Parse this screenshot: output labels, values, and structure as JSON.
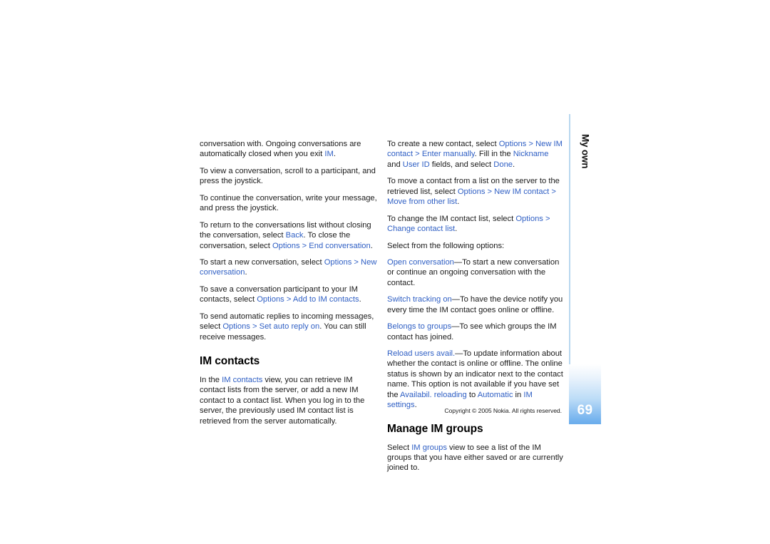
{
  "document": {
    "page_number": "69",
    "chapter_label": "My own",
    "copyright": "Copyright © 2005 Nokia. All rights reserved.",
    "accent_color": "#2f5fc4",
    "rail_line_color": "#b9d7ef",
    "page_tab_color": "#6aacec"
  },
  "left_column": {
    "paragraphs": [
      {
        "id": "p-ongoing-conversations",
        "runs": [
          {
            "t": "conversation with. Ongoing conversations are automatically closed when you exit ",
            "s": "plain"
          },
          {
            "t": "IM",
            "s": "ui"
          },
          {
            "t": ".",
            "s": "plain"
          }
        ]
      },
      {
        "id": "p-view-conversation",
        "runs": [
          {
            "t": "To view a conversation, scroll to a participant, and press the joystick.",
            "s": "plain"
          }
        ]
      },
      {
        "id": "p-continue-conversation",
        "runs": [
          {
            "t": "To continue the conversation, write your message, and press the joystick.",
            "s": "plain"
          }
        ]
      },
      {
        "id": "p-return-to-list",
        "runs": [
          {
            "t": "To return to the conversations list without closing the conversation, select ",
            "s": "plain"
          },
          {
            "t": "Back",
            "s": "ui"
          },
          {
            "t": ". To close the conversation, select ",
            "s": "plain"
          },
          {
            "t": "Options",
            "s": "ui"
          },
          {
            "t": " > ",
            "s": "sep"
          },
          {
            "t": "End conversation",
            "s": "ui"
          },
          {
            "t": ".",
            "s": "plain"
          }
        ]
      },
      {
        "id": "p-start-new-conversation",
        "runs": [
          {
            "t": "To start a new conversation, select ",
            "s": "plain"
          },
          {
            "t": "Options",
            "s": "ui"
          },
          {
            "t": " > ",
            "s": "sep"
          },
          {
            "t": "New conversation",
            "s": "ui"
          },
          {
            "t": ".",
            "s": "plain"
          }
        ]
      },
      {
        "id": "p-save-participant",
        "runs": [
          {
            "t": "To save a conversation participant to your IM contacts, select ",
            "s": "plain"
          },
          {
            "t": "Options",
            "s": "ui"
          },
          {
            "t": " > ",
            "s": "sep"
          },
          {
            "t": "Add to IM contacts",
            "s": "ui"
          },
          {
            "t": ".",
            "s": "plain"
          }
        ]
      },
      {
        "id": "p-auto-reply",
        "runs": [
          {
            "t": "To send automatic replies to incoming messages, select ",
            "s": "plain"
          },
          {
            "t": "Options",
            "s": "ui"
          },
          {
            "t": " > ",
            "s": "sep"
          },
          {
            "t": "Set auto reply on",
            "s": "ui"
          },
          {
            "t": ". You can still receive messages.",
            "s": "plain"
          }
        ]
      }
    ],
    "heading": "IM contacts",
    "after_heading_paragraphs": [
      {
        "id": "p-im-contacts-view",
        "runs": [
          {
            "t": "In the ",
            "s": "plain"
          },
          {
            "t": "IM contacts",
            "s": "ui"
          },
          {
            "t": " view, you can retrieve IM contact lists from the server, or add a new IM contact to a contact list. When you log in to the server, the previously used IM contact list is retrieved from the server automatically.",
            "s": "plain"
          }
        ]
      }
    ]
  },
  "right_column": {
    "paragraphs": [
      {
        "id": "p-create-new-contact",
        "runs": [
          {
            "t": "To create a new contact, select ",
            "s": "plain"
          },
          {
            "t": "Options",
            "s": "ui"
          },
          {
            "t": " > ",
            "s": "sep"
          },
          {
            "t": "New IM contact",
            "s": "ui"
          },
          {
            "t": " > ",
            "s": "sep"
          },
          {
            "t": "Enter manually",
            "s": "ui"
          },
          {
            "t": ". Fill in the ",
            "s": "plain"
          },
          {
            "t": "Nickname",
            "s": "ui"
          },
          {
            "t": " and ",
            "s": "plain"
          },
          {
            "t": "User ID",
            "s": "ui"
          },
          {
            "t": " fields, and select ",
            "s": "plain"
          },
          {
            "t": "Done",
            "s": "ui"
          },
          {
            "t": ".",
            "s": "plain"
          }
        ]
      },
      {
        "id": "p-move-contact",
        "runs": [
          {
            "t": "To move a contact from a list on the server to the retrieved list, select ",
            "s": "plain"
          },
          {
            "t": "Options",
            "s": "ui"
          },
          {
            "t": " > ",
            "s": "sep"
          },
          {
            "t": "New IM contact",
            "s": "ui"
          },
          {
            "t": " > ",
            "s": "sep"
          },
          {
            "t": "Move from other list",
            "s": "ui"
          },
          {
            "t": ".",
            "s": "plain"
          }
        ]
      },
      {
        "id": "p-change-contact-list",
        "runs": [
          {
            "t": "To change the IM contact list, select ",
            "s": "plain"
          },
          {
            "t": "Options",
            "s": "ui"
          },
          {
            "t": " > ",
            "s": "sep"
          },
          {
            "t": "Change contact list",
            "s": "ui"
          },
          {
            "t": ".",
            "s": "plain"
          }
        ]
      },
      {
        "id": "p-select-options-intro",
        "runs": [
          {
            "t": "Select from the following options:",
            "s": "plain"
          }
        ]
      },
      {
        "id": "p-open-conversation",
        "runs": [
          {
            "t": "Open conversation",
            "s": "ui"
          },
          {
            "t": "—To start a new conversation or continue an ongoing conversation with the contact.",
            "s": "plain"
          }
        ]
      },
      {
        "id": "p-switch-tracking-on",
        "runs": [
          {
            "t": "Switch tracking on",
            "s": "ui"
          },
          {
            "t": "—To have the device notify you every time the IM contact goes online or offline.",
            "s": "plain"
          }
        ]
      },
      {
        "id": "p-belongs-to-groups",
        "runs": [
          {
            "t": "Belongs to groups",
            "s": "ui"
          },
          {
            "t": "—To see which groups the IM contact has joined.",
            "s": "plain"
          }
        ]
      },
      {
        "id": "p-reload-users-avail",
        "runs": [
          {
            "t": "Reload users avail.",
            "s": "ui"
          },
          {
            "t": "—To update information about whether the contact is online or offline. The online status is shown by an indicator next to the contact name. This option is not available if you have set the ",
            "s": "plain"
          },
          {
            "t": "Availabil. reloading",
            "s": "ui"
          },
          {
            "t": " to ",
            "s": "plain"
          },
          {
            "t": "Automatic",
            "s": "ui"
          },
          {
            "t": " in ",
            "s": "plain"
          },
          {
            "t": "IM settings",
            "s": "ui"
          },
          {
            "t": ".",
            "s": "plain"
          }
        ]
      }
    ],
    "heading": "Manage IM groups",
    "after_heading_paragraphs": [
      {
        "id": "p-im-groups-view",
        "runs": [
          {
            "t": "Select ",
            "s": "plain"
          },
          {
            "t": "IM groups",
            "s": "ui"
          },
          {
            "t": " view to see a list of the IM groups that you have either saved or are currently joined to.",
            "s": "plain"
          }
        ]
      }
    ]
  }
}
